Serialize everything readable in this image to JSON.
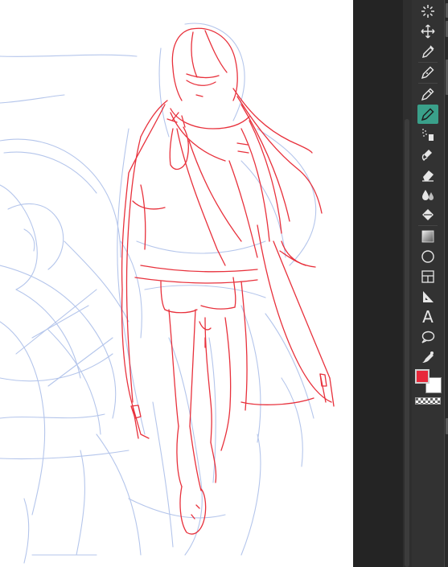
{
  "app": {
    "canvas": {
      "background": "#ffffff",
      "sketch_line_color": "#e8313c",
      "rough_sketch_color": "#a8bce8"
    },
    "toolbar": {
      "accent_color": "#3aa08a",
      "tools": [
        {
          "name": "magic-wand-tool",
          "icon": "magic-wand-icon"
        },
        {
          "name": "move-tool",
          "icon": "move-arrows-icon"
        },
        {
          "name": "eyedropper-tool",
          "icon": "eyedropper-icon"
        },
        {
          "name": "pen-tool",
          "icon": "pen-icon"
        },
        {
          "name": "pen-nib-tool",
          "icon": "pen-nib-icon"
        },
        {
          "name": "brush-pen-tool",
          "icon": "brush-pen-icon",
          "active": true
        },
        {
          "name": "airbrush-tool",
          "icon": "airbrush-icon"
        },
        {
          "name": "decoration-tool",
          "icon": "decoration-brush-icon"
        },
        {
          "name": "eraser-tool",
          "icon": "eraser-icon"
        },
        {
          "name": "blend-tool",
          "icon": "blend-drops-icon"
        },
        {
          "name": "fill-tool",
          "icon": "paint-bucket-icon"
        },
        {
          "name": "gradient-tool",
          "icon": "gradient-icon"
        },
        {
          "name": "figure-tool",
          "icon": "circle-shape-icon"
        },
        {
          "name": "frame-tool",
          "icon": "frame-border-icon"
        },
        {
          "name": "ruler-tool",
          "icon": "ruler-icon"
        },
        {
          "name": "text-tool",
          "icon": "text-icon",
          "glyph": "A"
        },
        {
          "name": "balloon-tool",
          "icon": "speech-balloon-icon"
        },
        {
          "name": "correct-line-tool",
          "icon": "correct-line-icon"
        }
      ]
    },
    "colors": {
      "foreground": "#e8283a",
      "background": "#ffffff"
    }
  }
}
